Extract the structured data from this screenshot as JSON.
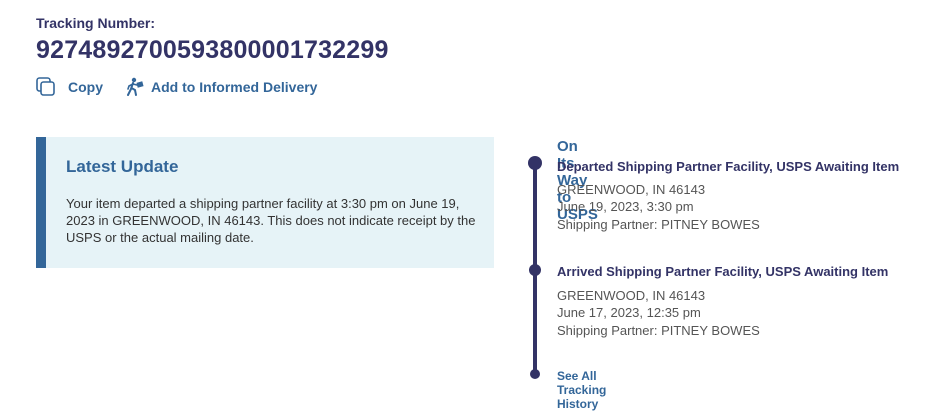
{
  "tracking": {
    "label": "Tracking Number:",
    "number": "9274892700593800001732299"
  },
  "actions": {
    "copy_label": "Copy",
    "informed_label": "Add to Informed Delivery"
  },
  "latest_update": {
    "title": "Latest Update",
    "text": "Your item departed a shipping partner facility at 3:30 pm on June 19, 2023 in GREENWOOD, IN 46143. This does not indicate receipt by the USPS or the actual mailing date."
  },
  "timeline": {
    "section_title": "On Its Way to USPS",
    "events": [
      {
        "title": "Departed Shipping Partner Facility, USPS Awaiting Item",
        "location": "GREENWOOD, IN 46143",
        "datetime": "June 19, 2023, 3:30 pm",
        "partner": "Shipping Partner: PITNEY BOWES"
      },
      {
        "title": "Arrived Shipping Partner Facility, USPS Awaiting Item",
        "location": "GREENWOOD, IN 46143",
        "datetime": "June 17, 2023, 12:35 pm",
        "partner": "Shipping Partner: PITNEY BOWES"
      }
    ],
    "see_all_label": "See All Tracking History"
  },
  "colors": {
    "navy": "#333366",
    "link_blue": "#336699",
    "update_bg": "#e6f3f7"
  },
  "icons": {
    "copy": "copy-icon",
    "informed_delivery": "walking-carrier-icon"
  }
}
